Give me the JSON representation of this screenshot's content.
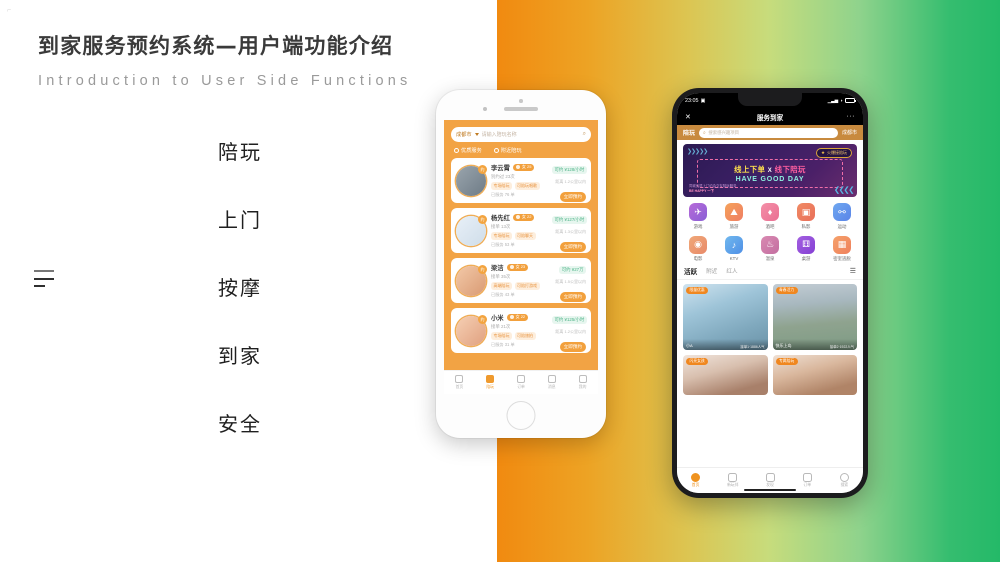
{
  "slide": {
    "title_cn": "到家服务预约系统—用户端功能介绍",
    "title_en": "Introduction to User Side Functions",
    "corner_mark": "⌐",
    "accent_orange": "#F18A10",
    "accent_green": "#24B968"
  },
  "nav_words": [
    {
      "label": "陪玩"
    },
    {
      "label": "上门"
    },
    {
      "label": "按摩"
    },
    {
      "label": "到家"
    },
    {
      "label": "安全"
    }
  ],
  "phone_left": {
    "search": {
      "city": "成都市",
      "placeholder": "请输入陪玩名称",
      "search_icon": "search-icon"
    },
    "filters": [
      {
        "label": "优质服务",
        "icon": "refresh-icon"
      },
      {
        "label": "附近陪玩",
        "icon": "location-icon"
      }
    ],
    "list": [
      {
        "name": "李云霄",
        "gender_tag": "女 25",
        "subtitle": "别约过 23次",
        "tags": [
          "专场陪玩",
          "可陪玩唱歌"
        ],
        "meta": "已服务 76 单",
        "price": "可约 ¥128/小时",
        "distance": "距离 1.2公里以内",
        "button": "立即预约"
      },
      {
        "name": "杨先红",
        "gender_tag": "女 22",
        "subtitle": "接单 13次",
        "tags": [
          "专场陪玩",
          "可陪聊天"
        ],
        "meta": "已服务 53 单",
        "price": "可约 ¥127/小时",
        "distance": "距离 1.3公里以内",
        "button": "立即预约"
      },
      {
        "name": "梁洁",
        "gender_tag": "女 23",
        "subtitle": "接单 35次",
        "tags": [
          "高端陪玩",
          "可陪打游戏"
        ],
        "meta": "已服务 43 单",
        "price": "可约 ¥27万",
        "distance": "距离 1.5公里以内",
        "button": "立即预约"
      },
      {
        "name": "小米",
        "gender_tag": "女 22",
        "subtitle": "接单 21次",
        "tags": [
          "专场陪玩",
          "可陪旅拍"
        ],
        "meta": "已服务 31 单",
        "price": "可约 ¥125/小时",
        "distance": "距离 1.2公里以内",
        "button": "立即预约"
      }
    ],
    "bottom_nav": [
      {
        "label": "首页",
        "icon": "home-icon",
        "active": false
      },
      {
        "label": "陪玩",
        "icon": "people-icon",
        "active": true
      },
      {
        "label": "订单",
        "icon": "order-icon",
        "active": false
      },
      {
        "label": "消息",
        "icon": "message-icon",
        "active": false
      },
      {
        "label": "我的",
        "icon": "user-icon",
        "active": false
      }
    ]
  },
  "phone_right": {
    "status": {
      "time": "23:05",
      "signal": "signal-icon",
      "wifi": "wifi-icon",
      "battery": "battery-icon"
    },
    "header": {
      "close": "✕",
      "title": "服务到家",
      "more": "···"
    },
    "search": {
      "logo": "陪玩",
      "placeholder": "搜索感兴趣项目",
      "city": "成都市",
      "search_icon": "search-icon"
    },
    "banner": {
      "arrows_left": "❯❯❯❯❯",
      "arrows_right": "❮❮❮❮",
      "pill": "火爆接陪玩",
      "pill_icon": "star-icon",
      "line1_a": "线上下单",
      "line1_x": "X",
      "line1_b": "线下陪玩",
      "line2": "HAVE GOOD DAY",
      "sub1": "同城优质上门约会交友陪玩服务",
      "sub2": "BE HAPPY 一下"
    },
    "grid": [
      [
        {
          "label": "游戏",
          "icon": "gamepad-icon",
          "glyph": "🎮",
          "color1": "#b76bd8",
          "color2": "#8a5fd6"
        },
        {
          "label": "旅游",
          "icon": "travel-icon",
          "glyph": "⛰",
          "color1": "#f5a25a",
          "color2": "#ef7e63"
        },
        {
          "label": "酒吧",
          "icon": "bar-icon",
          "glyph": "🍸",
          "color1": "#f48fa8",
          "color2": "#ea6f92"
        },
        {
          "label": "私影",
          "icon": "film-icon",
          "glyph": "🎬",
          "color1": "#f08a64",
          "color2": "#e96f5a"
        },
        {
          "label": "运动",
          "icon": "sport-icon",
          "glyph": "🏸",
          "color1": "#6fa8f0",
          "color2": "#5a84e8"
        }
      ],
      [
        {
          "label": "电影",
          "icon": "movie-icon",
          "glyph": "🎞",
          "color1": "#f0a878",
          "color2": "#e88a6a"
        },
        {
          "label": "KTV",
          "icon": "mic-icon",
          "glyph": "🎤",
          "color1": "#70b8ee",
          "color2": "#4f8fe6"
        },
        {
          "label": "温泉",
          "icon": "spa-icon",
          "glyph": "♨",
          "color1": "#d98ab2",
          "color2": "#c36ea0"
        },
        {
          "label": "桌游",
          "icon": "boardgame-icon",
          "glyph": "🎲",
          "color1": "#a35fe0",
          "color2": "#8540d4"
        },
        {
          "label": "密室逃脱",
          "icon": "escape-icon",
          "glyph": "🔒",
          "color1": "#f5a26a",
          "color2": "#ef7f5c"
        }
      ]
    ],
    "tabs": [
      {
        "label": "活跃",
        "active": true
      },
      {
        "label": "附近",
        "active": false
      },
      {
        "label": "红人",
        "active": false
      }
    ],
    "tab_menu_icon": "list-menu-icon",
    "photo_cards": [
      {
        "tag": "限量优惠",
        "name": "小A",
        "info": "接单1·1886人气"
      },
      {
        "tag": "青春活力",
        "name": "快乐上岛",
        "info": "接单2·1922人气"
      },
      {
        "tag": "闪亮女孩",
        "name": "",
        "info": ""
      },
      {
        "tag": "专属陪玩",
        "name": "",
        "info": ""
      }
    ],
    "bottom_nav": [
      {
        "label": "首页",
        "icon": "home-icon",
        "active": true
      },
      {
        "label": "新玩伴",
        "icon": "people-icon",
        "active": false
      },
      {
        "label": "发现",
        "icon": "discover-icon",
        "active": false
      },
      {
        "label": "订单",
        "icon": "order-icon",
        "active": false
      },
      {
        "label": "搜索",
        "icon": "search-icon",
        "active": false
      }
    ]
  }
}
